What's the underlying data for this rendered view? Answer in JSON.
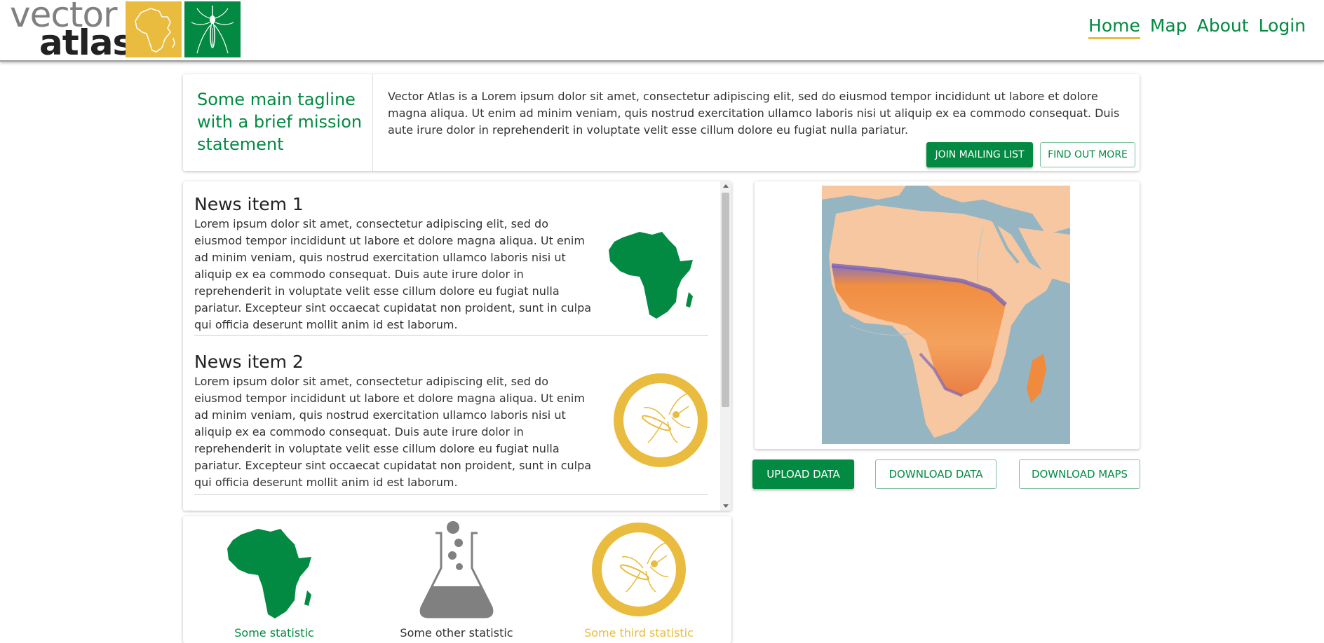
{
  "header": {
    "logo_line_1": "vector",
    "logo_line_2": "atlas",
    "nav": [
      {
        "label": "Home",
        "active": true
      },
      {
        "label": "Map",
        "active": false
      },
      {
        "label": "About",
        "active": false
      },
      {
        "label": "Login",
        "active": false
      }
    ]
  },
  "intro": {
    "tagline": "Some main tagline with a brief mission statement",
    "text": "Vector Atlas is a Lorem ipsum dolor sit amet, consectetur adipiscing elit, sed do eiusmod tempor incididunt ut labore et dolore magna aliqua. Ut enim ad minim veniam, quis nostrud exercitation ullamco laboris nisi ut aliquip ex ea commodo consequat. Duis aute irure dolor in reprehenderit in voluptate velit esse cillum dolore eu fugiat nulla pariatur.",
    "join_label": "JOIN MAILING LIST",
    "more_label": "FIND OUT MORE"
  },
  "news": [
    {
      "title": "News item 1",
      "body": "Lorem ipsum dolor sit amet, consectetur adipiscing elit, sed do eiusmod tempor incididunt ut labore et dolore magna aliqua. Ut enim ad minim veniam, quis nostrud exercitation ullamco laboris nisi ut aliquip ex ea commodo consequat. Duis aute irure dolor in reprehenderit in voluptate velit esse cillum dolore eu fugiat nulla pariatur. Excepteur sint occaecat cupidatat non proident, sunt in culpa qui officia deserunt mollit anim id est laborum.",
      "icon": "africa-icon"
    },
    {
      "title": "News item 2",
      "body": "Lorem ipsum dolor sit amet, consectetur adipiscing elit, sed do eiusmod tempor incididunt ut labore et dolore magna aliqua. Ut enim ad minim veniam, quis nostrud exercitation ullamco laboris nisi ut aliquip ex ea commodo consequat. Duis aute irure dolor in reprehenderit in voluptate velit esse cillum dolore eu fugiat nulla pariatur. Excepteur sint occaecat cupidatat non proident, sunt in culpa qui officia deserunt mollit anim id est laborum.",
      "icon": "mosquito-icon"
    }
  ],
  "stats": [
    {
      "label": "Some statistic",
      "color": "#038a42",
      "icon": "africa-icon"
    },
    {
      "label": "Some other statistic",
      "color": "#333333",
      "icon": "flask-icon"
    },
    {
      "label": "Some third statistic",
      "color": "#e9bb3e",
      "icon": "mosquito-icon"
    }
  ],
  "actions": {
    "upload": "UPLOAD DATA",
    "download_data": "DOWNLOAD DATA",
    "download_maps": "DOWNLOAD MAPS"
  },
  "colors": {
    "brand_green": "#038a42",
    "brand_yellow": "#e9bb3e",
    "grey": "#808080"
  }
}
